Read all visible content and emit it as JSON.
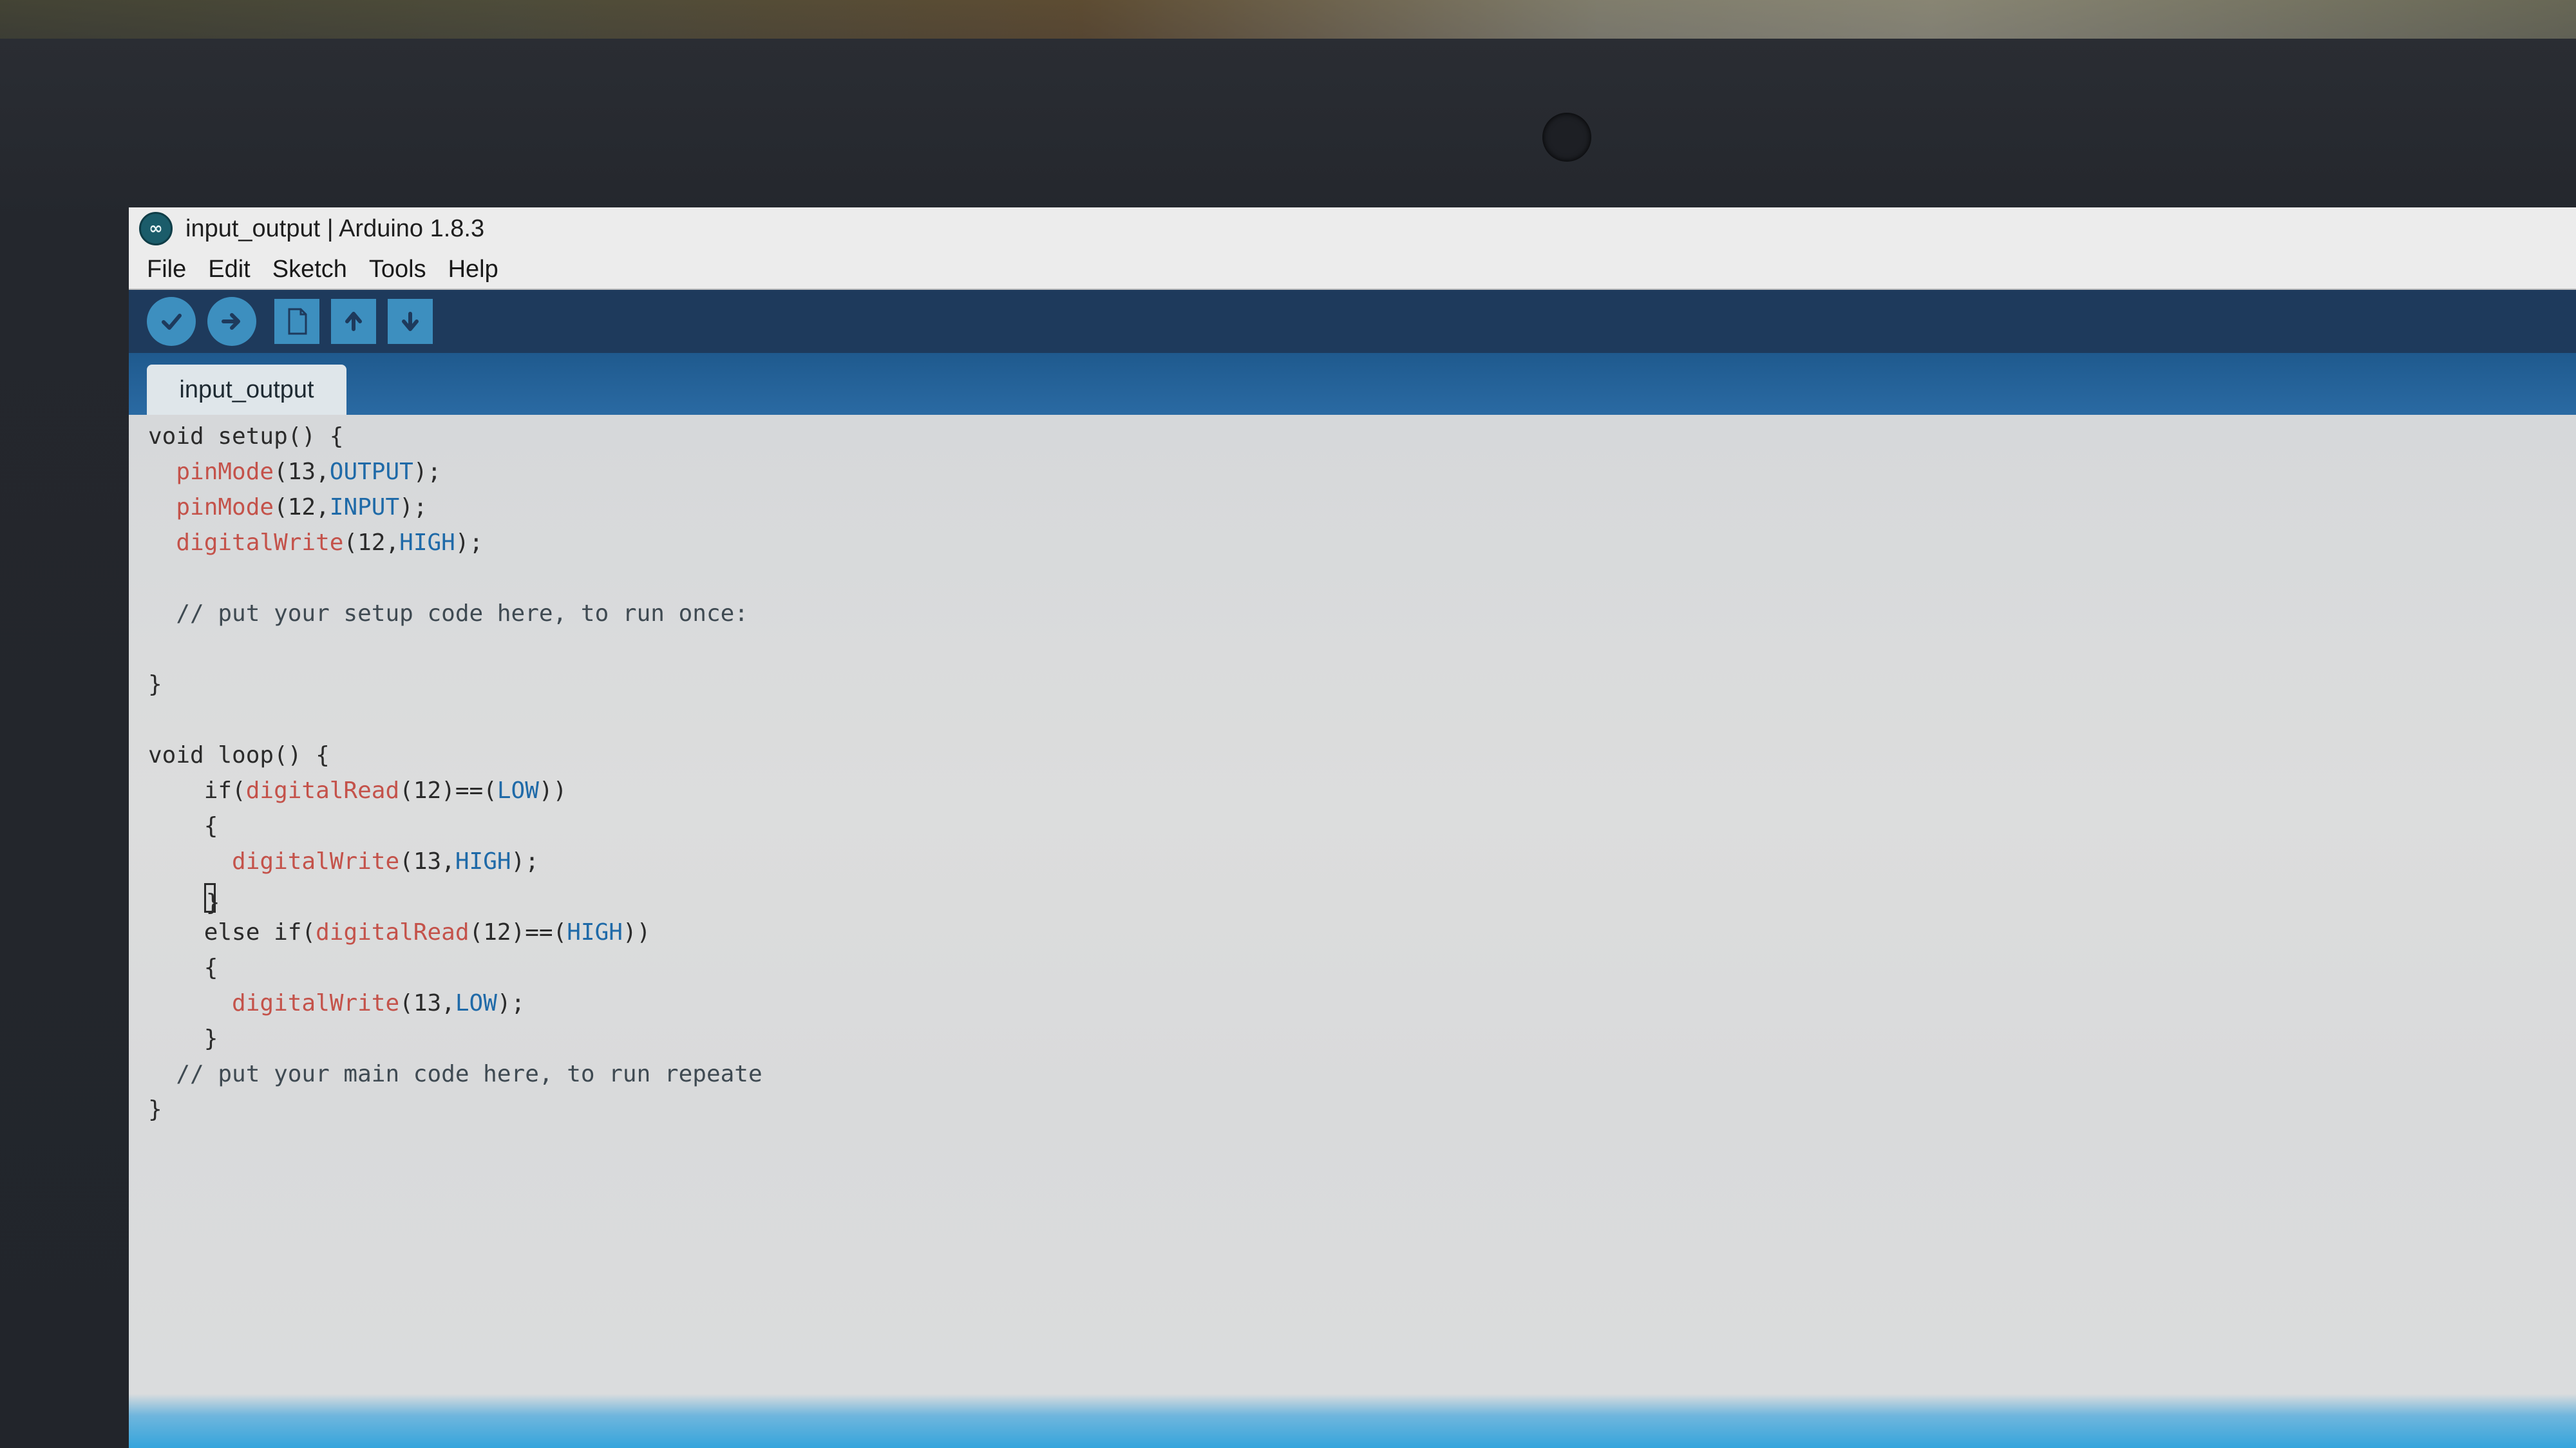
{
  "window": {
    "title": "input_output | Arduino 1.8.3",
    "logo": "arduino-logo"
  },
  "menu": [
    "File",
    "Edit",
    "Sketch",
    "Tools",
    "Help"
  ],
  "toolbar": {
    "buttons": [
      "verify-icon",
      "upload-icon",
      "new-icon",
      "open-icon",
      "save-icon"
    ]
  },
  "tabs": [
    {
      "label": "input_output"
    }
  ],
  "code": {
    "lines": [
      [
        {
          "t": "void setup() {",
          "c": "kw"
        }
      ],
      [
        {
          "t": "  ",
          "c": "kw"
        },
        {
          "t": "pinMode",
          "c": "fn"
        },
        {
          "t": "(13,",
          "c": "kw"
        },
        {
          "t": "OUTPUT",
          "c": "const"
        },
        {
          "t": ");",
          "c": "kw"
        }
      ],
      [
        {
          "t": "  ",
          "c": "kw"
        },
        {
          "t": "pinMode",
          "c": "fn"
        },
        {
          "t": "(12,",
          "c": "kw"
        },
        {
          "t": "INPUT",
          "c": "const"
        },
        {
          "t": ");",
          "c": "kw"
        }
      ],
      [
        {
          "t": "  ",
          "c": "kw"
        },
        {
          "t": "digitalWrite",
          "c": "fn"
        },
        {
          "t": "(12,",
          "c": "kw"
        },
        {
          "t": "HIGH",
          "c": "const"
        },
        {
          "t": ");",
          "c": "kw"
        }
      ],
      [
        {
          "t": "",
          "c": "kw"
        }
      ],
      [
        {
          "t": "  // put your setup code here, to run once:",
          "c": "cm"
        }
      ],
      [
        {
          "t": "",
          "c": "kw"
        }
      ],
      [
        {
          "t": "}",
          "c": "kw"
        }
      ],
      [
        {
          "t": "",
          "c": "kw"
        }
      ],
      [
        {
          "t": "void loop() {",
          "c": "kw"
        }
      ],
      [
        {
          "t": "    if(",
          "c": "kw"
        },
        {
          "t": "digitalRead",
          "c": "fn"
        },
        {
          "t": "(12)==(",
          "c": "kw"
        },
        {
          "t": "LOW",
          "c": "const"
        },
        {
          "t": "))",
          "c": "kw"
        }
      ],
      [
        {
          "t": "    {",
          "c": "kw"
        }
      ],
      [
        {
          "t": "      ",
          "c": "kw"
        },
        {
          "t": "digitalWrite",
          "c": "fn"
        },
        {
          "t": "(13,",
          "c": "kw"
        },
        {
          "t": "HIGH",
          "c": "const"
        },
        {
          "t": ");",
          "c": "kw"
        }
      ],
      [
        {
          "t": "    ",
          "c": "kw"
        },
        {
          "t": "}",
          "c": "cursor"
        }
      ],
      [
        {
          "t": "    else if(",
          "c": "kw"
        },
        {
          "t": "digitalRead",
          "c": "fn"
        },
        {
          "t": "(12)==(",
          "c": "kw"
        },
        {
          "t": "HIGH",
          "c": "const"
        },
        {
          "t": "))",
          "c": "kw"
        }
      ],
      [
        {
          "t": "    {",
          "c": "kw"
        }
      ],
      [
        {
          "t": "      ",
          "c": "kw"
        },
        {
          "t": "digitalWrite",
          "c": "fn"
        },
        {
          "t": "(13,",
          "c": "kw"
        },
        {
          "t": "LOW",
          "c": "const"
        },
        {
          "t": ");",
          "c": "kw"
        }
      ],
      [
        {
          "t": "    }",
          "c": "kw"
        }
      ],
      [
        {
          "t": "  // put your main code here, to run repeate",
          "c": "cm"
        }
      ],
      [
        {
          "t": "}",
          "c": "kw"
        }
      ]
    ]
  },
  "colors": {
    "toolbar_bg": "#1e3a5c",
    "toolbar_button": "#3d8fbf",
    "tab_strip": "#2a6aa3",
    "function": "#c4524a",
    "constant": "#1f6aa8"
  }
}
